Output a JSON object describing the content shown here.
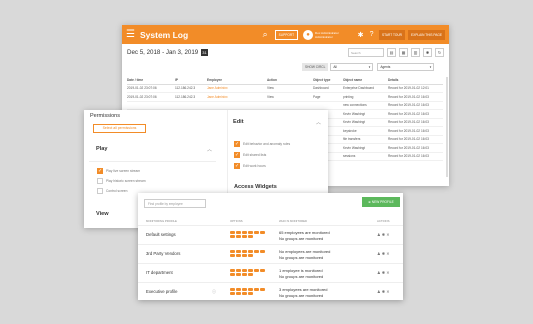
{
  "syslog": {
    "title": "System Log",
    "support": "SUPPORT",
    "user_name": "Doc Administrator",
    "user_sub": "Administrator",
    "start_tour": "START TOUR",
    "explain": "EXPLAIN THIS PAGE",
    "date_range": "Dec 5, 2018 - Jan 3, 2019",
    "cal_icon": "31",
    "search_placeholder": "Search",
    "show_circles": "SHOW CIRCL",
    "circle_select": "All",
    "agents_select": "Agents",
    "columns": [
      "Date / time",
      "IP",
      "Employee",
      "Action",
      "Object type",
      "Object name",
      "Details"
    ],
    "rows": [
      [
        "2019-01-02 23:07:06",
        "112.186.242.3",
        "Jane Adminixx",
        "View",
        "Dashboard",
        "Enterprise Dashboard",
        "Record for 2019-01-02 12:01"
      ],
      [
        "2019-01-02 23:07:06",
        "112.186.242.3",
        "Jane Adminixx",
        "View",
        "Page",
        "printing",
        "Record for 2019-01-02 16:03"
      ],
      [
        "",
        "",
        "",
        "",
        "",
        "new connections",
        "Record for 2019-01-02 16:03"
      ],
      [
        "",
        "",
        "",
        "",
        "",
        "Kevin Washingt",
        "Record for 2019-01-02 16:03"
      ],
      [
        "",
        "",
        "",
        "",
        "",
        "Kevin Washingt",
        "Record for 2019-01-02 16:03"
      ],
      [
        "",
        "",
        "",
        "",
        "",
        "keystroke",
        "Record for 2019-01-02 16:03"
      ],
      [
        "",
        "",
        "",
        "",
        "",
        "file transfers",
        "Record for 2019-01-02 16:03"
      ],
      [
        "",
        "",
        "",
        "",
        "",
        "Kevin Washingt",
        "Record for 2019-01-02 16:03"
      ],
      [
        "",
        "",
        "",
        "",
        "",
        "sessions",
        "Record for 2019-01-02 16:03"
      ]
    ]
  },
  "permissions": {
    "title": "Permissions",
    "select_all": "Select all permissions",
    "play_label": "Play",
    "play_options": [
      {
        "label": "Play live screen stream",
        "checked": true
      },
      {
        "label": "Play historic screen stream",
        "checked": false
      },
      {
        "label": "Control screen",
        "checked": false
      }
    ],
    "view_label": "View",
    "edit_label": "Edit",
    "edit_options": [
      {
        "label": "Edit behavior and anomaly rules",
        "checked": true
      },
      {
        "label": "Edit shared lists",
        "checked": true
      },
      {
        "label": "Edit work hours",
        "checked": true
      }
    ],
    "access_widgets_label": "Access Widgets"
  },
  "monitoring": {
    "search_placeholder": "Find profile by employee",
    "new_profile": "NEW PROFILE",
    "col_profile": "MONITORING PROFILE",
    "col_options": "OPTIONS",
    "col_monitored": "WHO IS MONITORED",
    "col_actions": "ACTIONS",
    "rows": [
      {
        "name": "Default settings",
        "line1": "65 employees are monitored",
        "line2": "No groups are monitored",
        "info": false
      },
      {
        "name": "3rd Party Vendors",
        "line1": "No employees are monitored",
        "line2": "No groups are monitored",
        "info": false
      },
      {
        "name": "IT department",
        "line1": "1 employee is monitored",
        "line2": "No groups are monitored",
        "info": false
      },
      {
        "name": "Executive profile",
        "line1": "3 employees are monitored",
        "line2": "No groups are monitored",
        "info": true
      }
    ]
  },
  "colors": {
    "accent": "#f28c28",
    "success": "#5cb85c",
    "background": "#d9d9d9"
  }
}
